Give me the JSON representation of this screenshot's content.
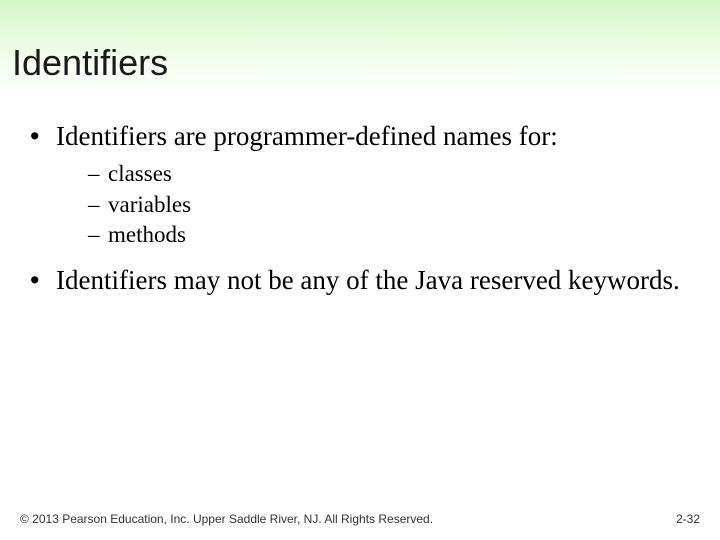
{
  "slide": {
    "title": "Identifiers",
    "bullets": [
      {
        "text": "Identifiers are programmer-defined names for:",
        "sub": [
          "classes",
          "variables",
          "methods"
        ]
      },
      {
        "text": "Identifiers may not be any of the Java reserved keywords.",
        "sub": []
      }
    ],
    "footer": {
      "copyright": "© 2013 Pearson Education, Inc. Upper Saddle River, NJ. All Rights Reserved.",
      "page": "2-32"
    }
  }
}
